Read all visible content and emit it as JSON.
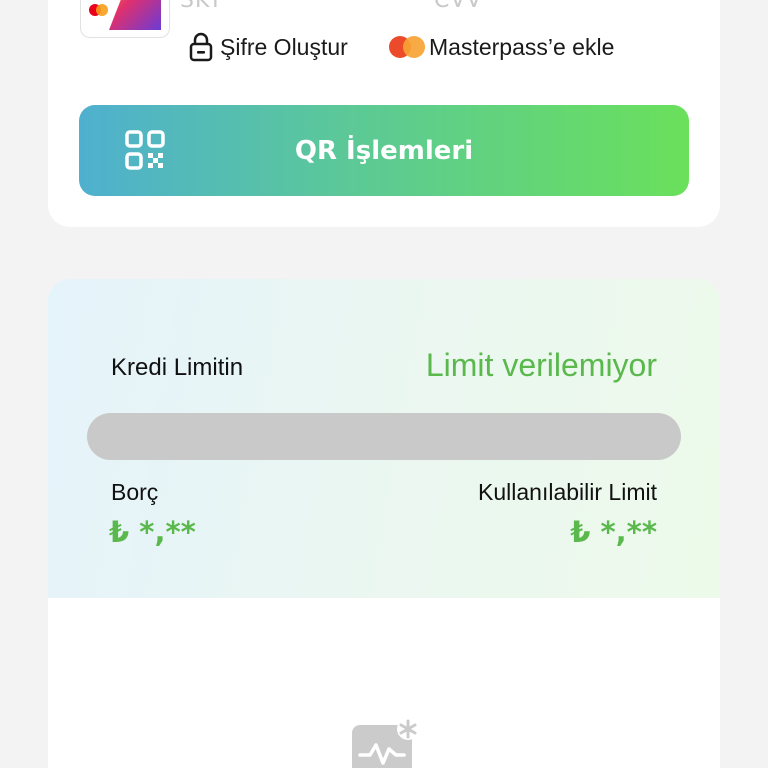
{
  "top_card": {
    "cut_text_left": "SKT",
    "cut_text_right": "CVV",
    "create_password_label": "Şifre Oluştur",
    "masterpass_label": "Masterpass’e ekle",
    "qr_button_label": "QR İşlemleri"
  },
  "credit": {
    "title": "Kredi Limitin",
    "status": "Limit verilemiyor",
    "usage_fraction": 0,
    "debt_label": "Borç",
    "debt_value": "₺ *,**",
    "available_label": "Kullanılabilir Limit",
    "available_value": "₺ *,**"
  },
  "colors": {
    "accent_green": "#5ab84d",
    "qr_gradient_start": "#4fb0cf",
    "qr_gradient_end": "#6ae05b",
    "bar_track": "#c9c9c9"
  },
  "icons": [
    "lock-icon",
    "masterpass-icon",
    "qr-code-icon",
    "activity-icon"
  ]
}
